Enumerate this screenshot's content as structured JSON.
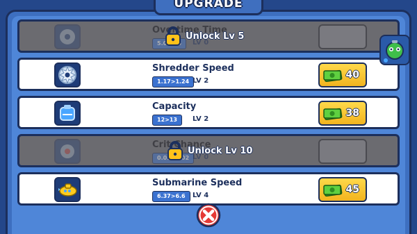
{
  "title": "UPGRADE",
  "rows": [
    {
      "name": "Overtime Time",
      "stat": "5.0>5.5",
      "level": "LV 0",
      "locked": true,
      "unlock_text": "Unlock Lv 5",
      "icon": "sawblade-icon"
    },
    {
      "name": "Shredder Speed",
      "stat": "1.17>1.24",
      "level": "LV 2",
      "locked": false,
      "cost": "40",
      "icon": "sawblade-icon"
    },
    {
      "name": "Capacity",
      "stat": "12>13",
      "level": "LV 2",
      "locked": false,
      "cost": "38",
      "icon": "capacity-tank-icon"
    },
    {
      "name": "Crit Chance",
      "stat": "0.01>0.02",
      "level": "LV 0",
      "locked": true,
      "unlock_text": "Unlock Lv 10",
      "icon": "crit-gear-icon"
    },
    {
      "name": "Submarine Speed",
      "stat": "6.37>6.6",
      "level": "LV 4",
      "locked": false,
      "cost": "45",
      "icon": "submarine-icon"
    }
  ],
  "side_button": {
    "icon": "robot-helper-icon"
  },
  "close_button": {
    "icon": "close-x-icon"
  },
  "colors": {
    "panel": "#4f86d8",
    "border": "#1c2f5c",
    "buy": "#f2b41f",
    "cash": "#4fbf3a",
    "close": "#e53935"
  }
}
